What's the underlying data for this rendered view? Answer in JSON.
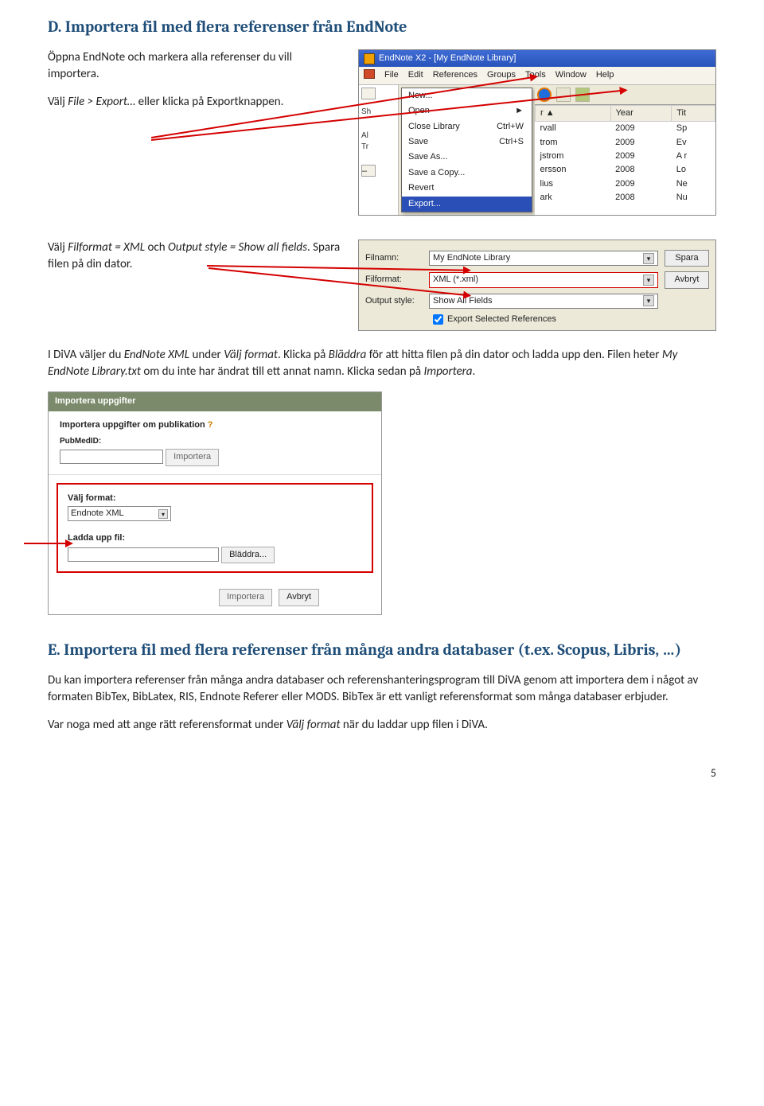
{
  "heading_d": "D. Importera fil med flera referenser från EndNote",
  "para_d1a": "Öppna EndNote och markera alla referenser du vill importera.",
  "para_d1b_pre": "Välj ",
  "para_d1b_it": "File > Export… ",
  "para_d1b_post": "eller klicka på Exportknappen.",
  "para_d2_pre": "Välj ",
  "para_d2_it1": "Filformat = XML",
  "para_d2_mid": " och ",
  "para_d2_it2": "Output style = Show all fields",
  "para_d2_post": ". Spara filen på din dator.",
  "para_d3_a": "I DiVA väljer du ",
  "para_d3_it1": "EndNote XML",
  "para_d3_b": " under ",
  "para_d3_it2": "Välj format",
  "para_d3_c": ". Klicka på ",
  "para_d3_it3": "Bläddra",
  "para_d3_d": " för att hitta filen på din dator och ladda upp den. Filen heter ",
  "para_d3_it4": "My EndNote Library.txt",
  "para_d3_e": " om du inte har ändrat till ett annat namn. Klicka sedan på ",
  "para_d3_it5": "Importera",
  "para_d3_f": ".",
  "endnote": {
    "title": "EndNote X2 - [My EndNote Library]",
    "menus": [
      "File",
      "Edit",
      "References",
      "Groups",
      "Tools",
      "Window",
      "Help"
    ],
    "left_labels": {
      "sh": "Sh",
      "al": "Al",
      "tr": "Tr"
    },
    "file_items": [
      {
        "label": "New...",
        "accel": ""
      },
      {
        "label": "Open",
        "accel": "►"
      },
      {
        "label": "Close Library",
        "accel": "Ctrl+W"
      },
      {
        "label": "Save",
        "accel": "Ctrl+S"
      },
      {
        "label": "Save As...",
        "accel": ""
      },
      {
        "label": "Save a Copy...",
        "accel": ""
      },
      {
        "label": "Revert",
        "accel": ""
      },
      {
        "label": "Export...",
        "accel": "",
        "sel": true
      }
    ],
    "cols": [
      "r",
      "Year",
      "Tit"
    ],
    "rows": [
      {
        "a": "rvall",
        "y": "2009",
        "t": "Sp"
      },
      {
        "a": "trom",
        "y": "2009",
        "t": "Ev"
      },
      {
        "a": "jstrom",
        "y": "2009",
        "t": "A r"
      },
      {
        "a": "ersson",
        "y": "2008",
        "t": "Lo"
      },
      {
        "a": "lius",
        "y": "2009",
        "t": "Ne"
      },
      {
        "a": "ark",
        "y": "2008",
        "t": "Nu"
      }
    ]
  },
  "exportdlg": {
    "filnamn_lbl": "Filnamn:",
    "filnamn_val": "My EndNote Library",
    "filformat_lbl": "Filformat:",
    "filformat_val": "XML (*.xml)",
    "output_lbl": "Output style:",
    "output_val": "Show All Fields",
    "chk": "Export Selected References",
    "spara": "Spara",
    "avbryt": "Avbryt"
  },
  "diva": {
    "bar": "Importera uppgifter",
    "q_label": "Importera uppgifter om publikation",
    "pubmed_label": "PubMedID:",
    "importera": "Importera",
    "valj_format": "Välj format:",
    "format_sel": "Endnote XML",
    "ladda": "Ladda upp fil:",
    "bladdra": "Bläddra...",
    "avbryt": "Avbryt"
  },
  "heading_e": "E. Importera fil med flera referenser från många andra databaser (t.ex. Scopus, Libris, …)",
  "para_e1": "Du kan importera referenser från många andra databaser och referenshanteringsprogram till DiVA genom att importera dem i något av formaten BibTex, BibLatex, RIS, Endnote Referer eller MODS. BibTex är ett vanligt referensformat som många databaser erbjuder.",
  "para_e2_a": "Var noga med att ange rätt referensformat under ",
  "para_e2_it": "Välj format",
  "para_e2_b": " när du laddar upp filen i DiVA.",
  "page": "5"
}
